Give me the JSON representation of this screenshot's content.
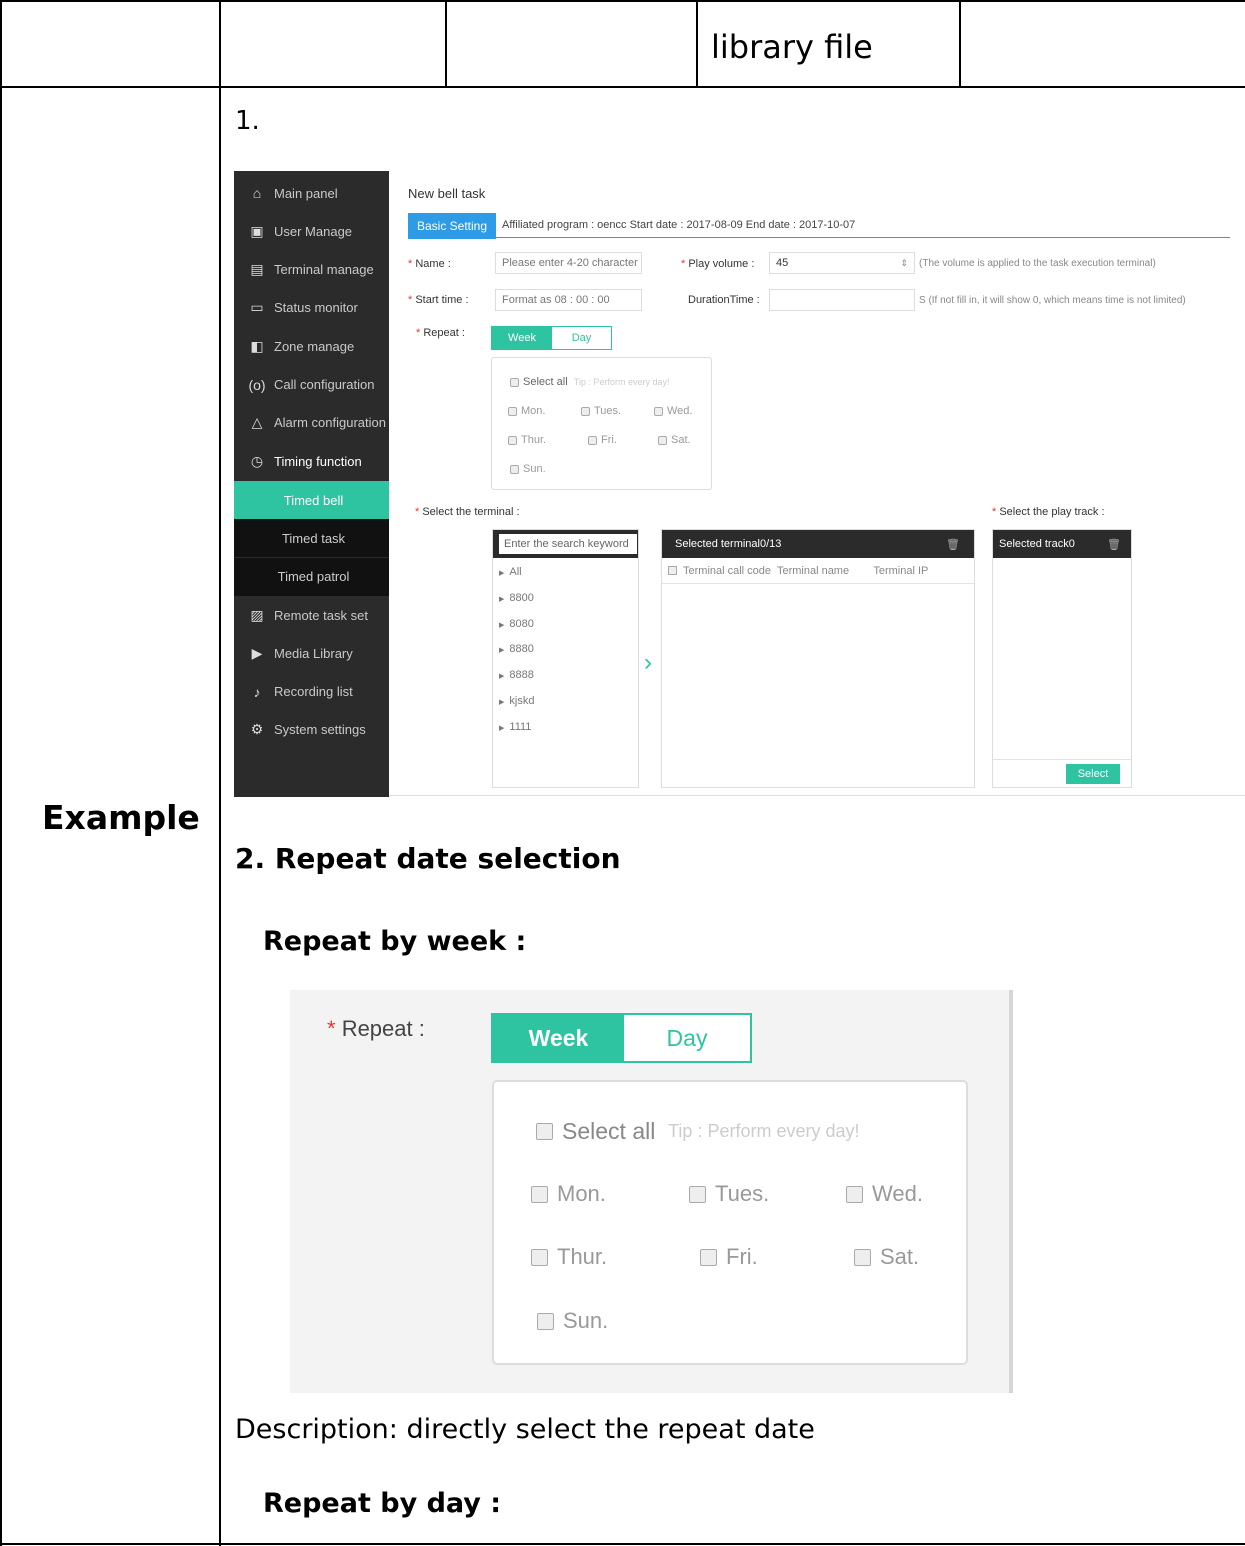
{
  "header": {
    "cell_text": "library file"
  },
  "row_label": "Example",
  "step1": "1.",
  "screenshot1": {
    "sidebar": [
      {
        "icon": "home-icon",
        "glyph": "⌂",
        "label": "Main panel"
      },
      {
        "icon": "user-icon",
        "glyph": "▣",
        "label": "User Manage"
      },
      {
        "icon": "terminal-icon",
        "glyph": "▤",
        "label": "Terminal manage"
      },
      {
        "icon": "monitor-icon",
        "glyph": "▭",
        "label": "Status monitor"
      },
      {
        "icon": "zone-icon",
        "glyph": "◧",
        "label": "Zone manage"
      },
      {
        "icon": "call-icon",
        "glyph": "(o)",
        "label": "Call configuration"
      },
      {
        "icon": "bell-icon",
        "glyph": "△",
        "label": "Alarm configuration"
      },
      {
        "icon": "timer-icon",
        "glyph": "◷",
        "label": "Timing function"
      }
    ],
    "sidebar_sub": [
      "Timed bell",
      "Timed task",
      "Timed patrol"
    ],
    "sidebar_bottom": [
      {
        "icon": "task-icon",
        "glyph": "▨",
        "label": "Remote task set"
      },
      {
        "icon": "media-icon",
        "glyph": "▶",
        "label": "Media Library"
      },
      {
        "icon": "mic-icon",
        "glyph": "♪",
        "label": "Recording list"
      },
      {
        "icon": "gear-icon",
        "glyph": "⚙",
        "label": "System settings"
      }
    ],
    "title": "New bell task",
    "tab_basic": "Basic Setting",
    "tab_info": "Affiliated program : oencc    Start date : 2017-08-09    End date : 2017-10-07",
    "name_label": "Name :",
    "name_placeholder": "Please enter 4-20 character",
    "volume_label": "Play volume :",
    "volume_value": "45",
    "volume_hint": "(The volume is applied to the task execution terminal)",
    "start_label": "Start time :",
    "start_placeholder": "Format as 08 : 00 : 00",
    "duration_label": "DurationTime :",
    "duration_hint": "S (If not fill in, it will show 0, which means time is not limited)",
    "repeat_label": "Repeat :",
    "week": "Week",
    "day": "Day",
    "select_all": "Select all",
    "tip": "Tip : Perform every day!",
    "days": [
      "Mon.",
      "Tues.",
      "Wed.",
      "Thur.",
      "Fri.",
      "Sat.",
      "Sun."
    ],
    "select_terminal": "Select the terminal :",
    "select_track": "Select the play track :",
    "search_placeholder": "Enter the search keyword",
    "selected_terminal": "Selected terminal0/13",
    "tree": [
      "All",
      "8800",
      "8080",
      "8880",
      "8888",
      "kjskd",
      "1111"
    ],
    "col_headers": "Terminal call code  Terminal name        Terminal IP",
    "selected_track": "Selected track0",
    "select_button": "Select",
    "colors": {
      "accent": "#2ec4a1",
      "tab_blue": "#2e9be6",
      "sidebar": "#2b2b2b"
    }
  },
  "section2_title": "2. Repeat date selection",
  "repeat_by_week": "Repeat by week :",
  "description": "Description: directly select the repeat date",
  "repeat_by_day": "Repeat by day :"
}
